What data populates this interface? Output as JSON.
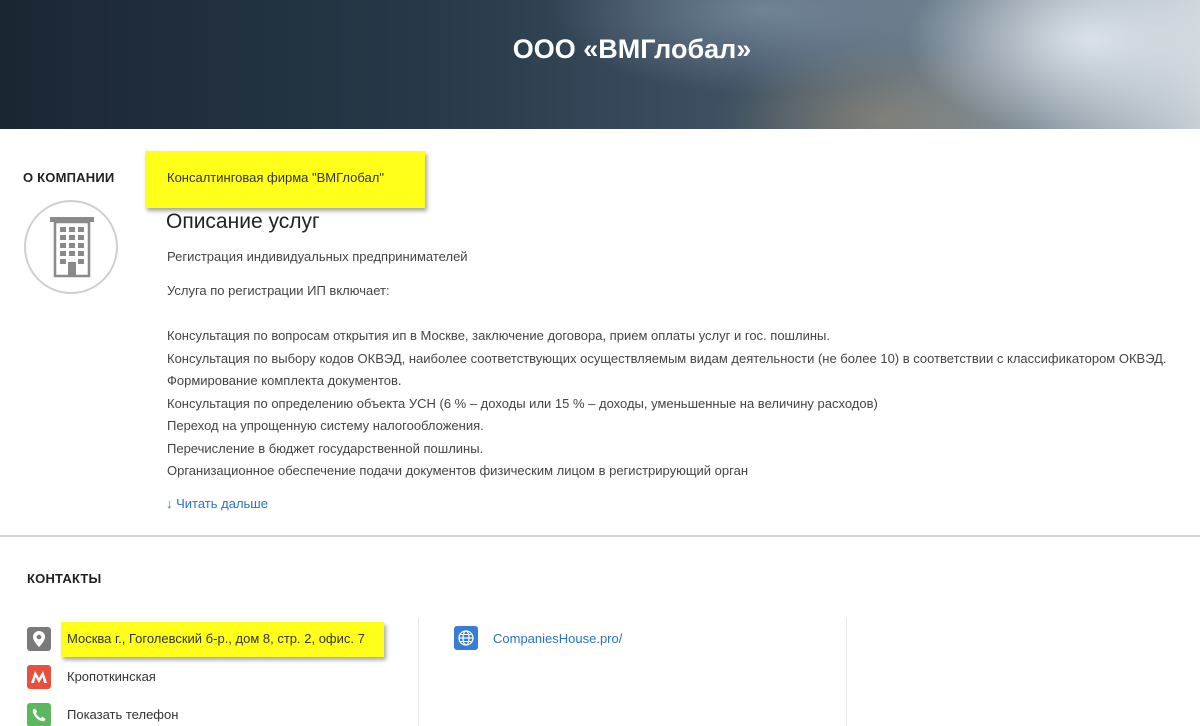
{
  "header": {
    "company_title": "ООО «ВМГлобал»"
  },
  "about": {
    "section_label": "О КОМПАНИИ",
    "company_name": "Консалтинговая фирма \"ВМГлобал\"",
    "services_heading": "Описание услуг",
    "description_lines": [
      "Регистрация индивидуальных предпринимателей",
      "Услуга по регистрации ИП включает:",
      "",
      "Консультация по вопросам открытия ип в Москве, заключение договора, прием оплаты услуг и гос. пошлины.",
      "Консультация по выбору кодов ОКВЭД, наиболее соответствующих осуществляемым видам деятельности (не более 10) в соответствии с классификатором ОКВЭД.",
      "Формирование комплекта документов.",
      "Консультация по определению объекта УСН (6 % – доходы или 15 % – доходы, уменьшенные на величину расходов)",
      "Переход на упрощенную систему налогообложения.",
      "Перечисление в бюджет государственной пошлины.",
      "Организационное обеспечение подачи документов физическим лицом в регистрирующий орган"
    ],
    "read_more": "↓ Читать дальше"
  },
  "contacts": {
    "section_label": "КОНТАКТЫ",
    "address": "Москва г., Гоголевский б-р., дом 8, стр. 2, офис. 7",
    "metro": "Кропоткинская",
    "phone_label": "Показать телефон",
    "website": "CompaniesHouse.pro/"
  },
  "colors": {
    "highlight": "#ffff1a",
    "link": "#2a73c7",
    "location_icon_bg": "#7a7a7a",
    "metro_icon_bg": "#e84f3d",
    "phone_icon_bg": "#5cb85c",
    "globe_icon_bg": "#3a7bd5"
  },
  "icons": {
    "company": "building-icon",
    "address": "location-pin-icon",
    "metro": "metro-icon",
    "phone": "phone-icon",
    "website": "globe-icon"
  }
}
